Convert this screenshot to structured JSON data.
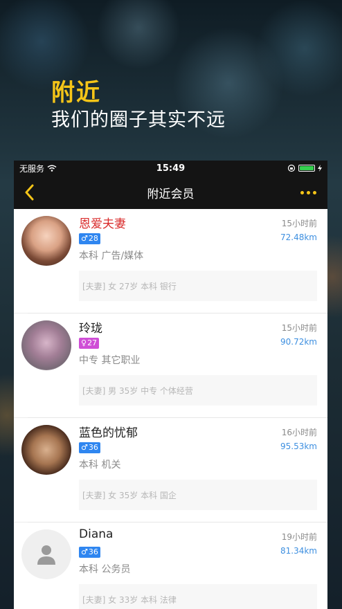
{
  "hero": {
    "title": "附近",
    "subtitle": "我们的圈子其实不远"
  },
  "statusbar": {
    "carrier": "无服务",
    "time": "15:49"
  },
  "navbar": {
    "title": "附近会员"
  },
  "colors": {
    "accent": "#f5c518",
    "highlight_name": "#d92b2b",
    "distance": "#3d8fe0",
    "male_badge": "#2f86f0",
    "female_badge": "#cf4ed6"
  },
  "members": [
    {
      "name": "恩爱夫妻",
      "gender_symbol": "♂",
      "age": "28",
      "meta": "本科 广告/媒体",
      "time": "15小时前",
      "distance": "72.48km",
      "desc": "[夫妻] 女 27岁 本科 银行"
    },
    {
      "name": "玲珑",
      "gender_symbol": "♀",
      "age": "27",
      "meta": "中专 其它职业",
      "time": "15小时前",
      "distance": "90.72km",
      "desc": "[夫妻] 男 35岁 中专 个体经营"
    },
    {
      "name": "蓝色的忧郁",
      "gender_symbol": "♂",
      "age": "36",
      "meta": "本科 机关",
      "time": "16小时前",
      "distance": "95.53km",
      "desc": "[夫妻] 女 35岁 本科 国企"
    },
    {
      "name": "Diana",
      "gender_symbol": "♂",
      "age": "36",
      "meta": "本科 公务员",
      "time": "19小时前",
      "distance": "81.34km",
      "desc": "[夫妻] 女 33岁 本科 法律"
    }
  ]
}
